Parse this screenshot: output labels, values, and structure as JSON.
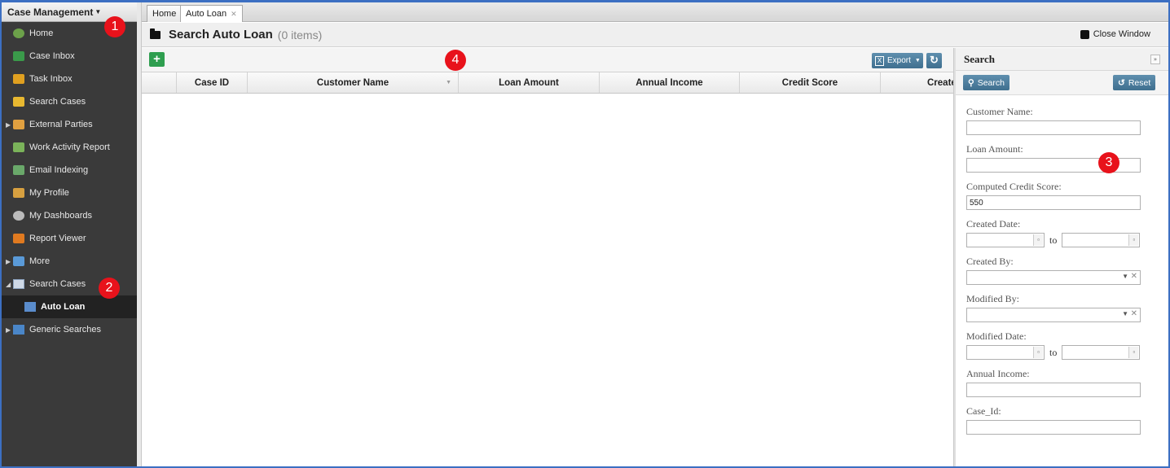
{
  "sidebar": {
    "header": "Case Management",
    "items": [
      {
        "label": "Home",
        "icon": "globe-icon",
        "color": "#6ca14a"
      },
      {
        "label": "Case Inbox",
        "icon": "inbox-icon",
        "color": "#3a9a4a"
      },
      {
        "label": "Task Inbox",
        "icon": "clipboard-icon",
        "color": "#e0a020"
      },
      {
        "label": "Search Cases",
        "icon": "folder-search-icon",
        "color": "#e8b830"
      },
      {
        "label": "External Parties",
        "icon": "people-icon",
        "color": "#e0a040",
        "expandable": true
      },
      {
        "label": "Work Activity Report",
        "icon": "map-icon",
        "color": "#7bb35a"
      },
      {
        "label": "Email Indexing",
        "icon": "email-icon",
        "color": "#6aa86a"
      },
      {
        "label": "My Profile",
        "icon": "user-icon",
        "color": "#d7a040"
      },
      {
        "label": "My Dashboards",
        "icon": "dashboard-icon",
        "color": "#bbbbbb"
      },
      {
        "label": "Report Viewer",
        "icon": "report-icon",
        "color": "#e07a20"
      },
      {
        "label": "More",
        "icon": "code-icon",
        "color": "#5a9ad8",
        "expandable": true
      }
    ],
    "tree": {
      "label": "Search Cases",
      "child": "Auto Loan"
    },
    "generic": "Generic Searches"
  },
  "tabs": [
    {
      "label": "Home"
    },
    {
      "label": "Auto Loan"
    }
  ],
  "title": {
    "text": "Search Auto Loan",
    "count": "(0 items)",
    "close": "Close Window"
  },
  "toolbar": {
    "export": "Export"
  },
  "columns": [
    "Case ID",
    "Customer Name",
    "Loan Amount",
    "Annual Income",
    "Credit Score",
    "Created"
  ],
  "search_panel": {
    "title": "Search",
    "search_btn": "Search",
    "reset_btn": "Reset",
    "fields": {
      "customer_name": {
        "label": "Customer Name:",
        "value": ""
      },
      "loan_amount": {
        "label": "Loan Amount:",
        "value": ""
      },
      "credit_score": {
        "label": "Computed Credit Score:",
        "value": "550"
      },
      "created_date": {
        "label": "Created Date:",
        "to": "to"
      },
      "created_by": {
        "label": "Created By:"
      },
      "modified_by": {
        "label": "Modified By:"
      },
      "modified_date": {
        "label": "Modified Date:",
        "to": "to"
      },
      "annual_income": {
        "label": "Annual Income:",
        "value": ""
      },
      "case_id": {
        "label": "Case_Id:",
        "value": ""
      }
    }
  },
  "badges": [
    "1",
    "2",
    "3",
    "4"
  ],
  "colors": {
    "badge": "#e8121b",
    "button": "#4a7c9c",
    "add": "#2e9e4f",
    "sidebar": "#3a3a3a"
  }
}
